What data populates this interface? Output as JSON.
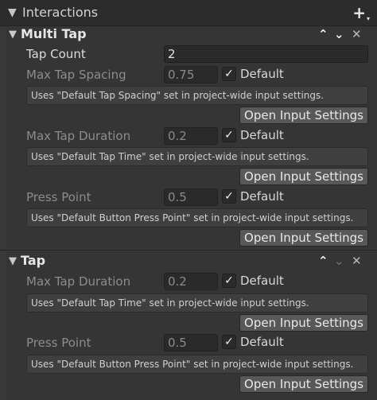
{
  "header": {
    "title": "Interactions",
    "expand_glyph": "▼",
    "add_icon": "+"
  },
  "multi_tap": {
    "title": "Multi Tap",
    "expand_glyph": "▼",
    "icons": {
      "up": "⌃",
      "down": "⌄",
      "close": "✕"
    },
    "tap_count": {
      "label": "Tap Count",
      "value": "2"
    },
    "max_tap_spacing": {
      "label": "Max Tap Spacing",
      "value": "0.75",
      "default_label": "Default",
      "checked_glyph": "✓",
      "info": "Uses \"Default Tap Spacing\" set in project-wide input settings.",
      "button": "Open Input Settings"
    },
    "max_tap_duration": {
      "label": "Max Tap Duration",
      "value": "0.2",
      "default_label": "Default",
      "checked_glyph": "✓",
      "info": "Uses \"Default Tap Time\" set in project-wide input settings.",
      "button": "Open Input Settings"
    },
    "press_point": {
      "label": "Press Point",
      "value": "0.5",
      "default_label": "Default",
      "checked_glyph": "✓",
      "info": "Uses \"Default Button Press Point\" set in project-wide input settings.",
      "button": "Open Input Settings"
    }
  },
  "tap": {
    "title": "Tap",
    "expand_glyph": "▼",
    "icons": {
      "up": "⌃",
      "down": "⌄",
      "close": "✕"
    },
    "max_tap_duration": {
      "label": "Max Tap Duration",
      "value": "0.2",
      "default_label": "Default",
      "checked_glyph": "✓",
      "info": "Uses \"Default Tap Time\" set in project-wide input settings.",
      "button": "Open Input Settings"
    },
    "press_point": {
      "label": "Press Point",
      "value": "0.5",
      "default_label": "Default",
      "checked_glyph": "✓",
      "info": "Uses \"Default Button Press Point\" set in project-wide input settings.",
      "button": "Open Input Settings"
    }
  }
}
